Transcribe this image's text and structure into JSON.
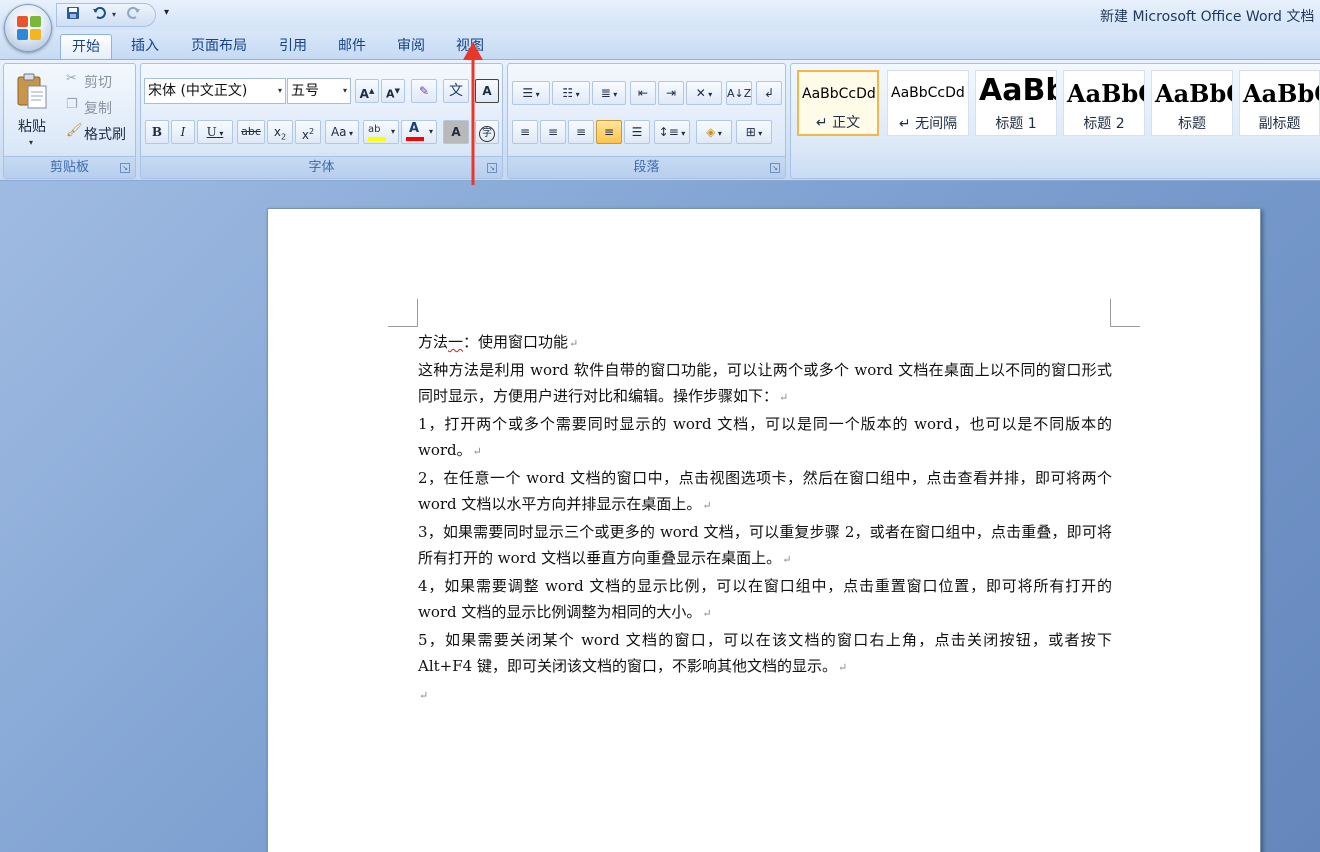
{
  "title_bar": {
    "document_title": "新建 Microsoft Office Word 文档",
    "quick_access": [
      "save-icon",
      "undo-icon",
      "redo-icon",
      "customize-icon"
    ]
  },
  "tabs": [
    {
      "label": "开始",
      "active": true
    },
    {
      "label": "插入"
    },
    {
      "label": "页面布局"
    },
    {
      "label": "引用"
    },
    {
      "label": "邮件"
    },
    {
      "label": "审阅"
    },
    {
      "label": "视图"
    }
  ],
  "ribbon": {
    "clipboard": {
      "paste": "粘贴",
      "cut": "剪切",
      "copy": "复制",
      "format_painter": "格式刷",
      "group_label": "剪贴板"
    },
    "font": {
      "font_name": "宋体 (中文正文)",
      "font_size": "五号",
      "group_label": "字体",
      "highlight_color": "#ffff00",
      "font_color": "#ff0000"
    },
    "paragraph": {
      "group_label": "段落"
    },
    "styles": [
      {
        "sample": "AaBbCcDd",
        "name": "↵ 正文",
        "active": true
      },
      {
        "sample": "AaBbCcDd",
        "name": "↵ 无间隔"
      },
      {
        "sample": "AaBb",
        "name": "标题 1"
      },
      {
        "sample": "AaBbC",
        "name": "标题 2"
      },
      {
        "sample": "AaBbC",
        "name": "标题"
      },
      {
        "sample": "AaBbC",
        "name": "副标题"
      }
    ]
  },
  "document": {
    "heading_pre": "方法",
    "heading_squiggle": "一",
    "heading_post": "：使用窗口功能",
    "paragraphs": [
      "这种方法是利用 word 软件自带的窗口功能，可以让两个或多个 word 文档在桌面上以不同的窗口形式同时显示，方便用户进行对比和编辑。操作步骤如下：",
      "1，打开两个或多个需要同时显示的 word 文档，可以是同一个版本的 word，也可以是不同版本的 word。",
      "2，在任意一个 word 文档的窗口中，点击视图选项卡，然后在窗口组中，点击查看并排，即可将两个 word 文档以水平方向并排显示在桌面上。",
      "3，如果需要同时显示三个或更多的 word 文档，可以重复步骤 2，或者在窗口组中，点击重叠，即可将所有打开的 word 文档以垂直方向重叠显示在桌面上。",
      "4，如果需要调整 word 文档的显示比例，可以在窗口组中，点击重置窗口位置，即可将所有打开的 word 文档的显示比例调整为相同的大小。",
      "5，如果需要关闭某个 word 文档的窗口，可以在该文档的窗口右上角，点击关闭按钮，或者按下 Alt+F4 键，即可关闭该文档的窗口，不影响其他文档的显示。"
    ],
    "paragraph_mark": "↵"
  },
  "colors": {
    "annotation_arrow": "#e8382a",
    "ribbon_accent": "#15428b"
  }
}
